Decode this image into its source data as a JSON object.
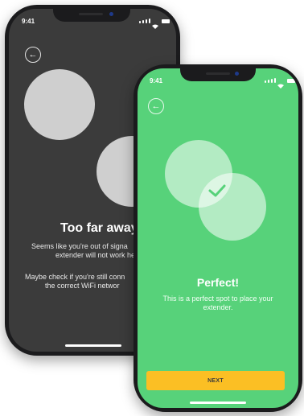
{
  "back_phone": {
    "status_time": "9:41",
    "title": "Too far away",
    "line1": "Seems like you're out of signa",
    "line2": "extender will not work he",
    "line3": "Maybe check if you're still conn",
    "line4": "the correct WiFi networ"
  },
  "front_phone": {
    "status_time": "9:41",
    "title": "Perfect!",
    "line1": "This is a perfect spot to place your",
    "line2": "extender.",
    "next_label": "NEXT",
    "check_icon": "checkmark-icon"
  },
  "colors": {
    "dark_screen": "#3b3b3b",
    "green_screen": "#57d27a",
    "button_yellow": "#fbbf24"
  },
  "icons": {
    "back": "arrow-left-icon"
  }
}
